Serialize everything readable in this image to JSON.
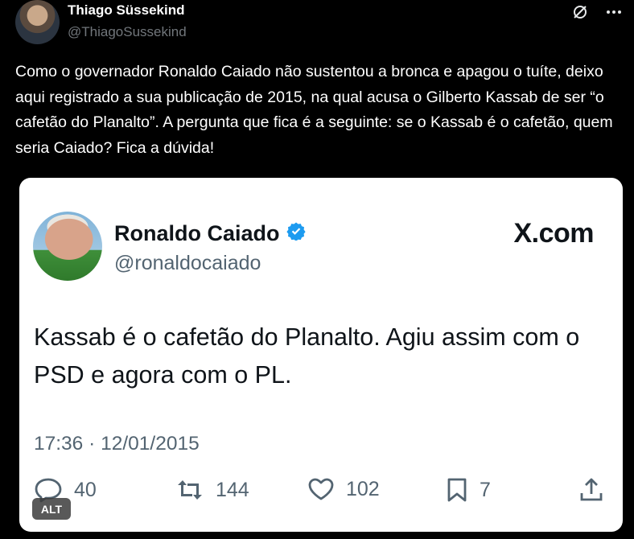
{
  "author": {
    "display_name": "Thiago Süssekind",
    "handle": "@ThiagoSussekind"
  },
  "post": {
    "text": "Como o governador Ronaldo Caiado não sustentou a bronca e apagou o tuíte, deixo aqui registrado a sua publicação de 2015, na qual acusa o Gilberto Kassab de ser “o cafetão do Planalto”. A pergunta que fica é a seguinte: se o Kassab é o cafetão, quem seria Caiado? Fica a dúvida!"
  },
  "embedded": {
    "display_name": "Ronaldo Caiado",
    "handle": "@ronaldocaiado",
    "brand": "X.com",
    "text": "Kassab é o cafetão do Planalto. Agiu assim com o PSD e agora com o PL.",
    "timestamp": "17:36 · 12/01/2015",
    "stats": {
      "replies": "40",
      "reposts": "144",
      "likes": "102",
      "bookmarks": "7"
    },
    "verified_color": "#1d9bf0"
  },
  "alt_badge": "ALT",
  "icons": [
    "grok-icon",
    "more-icon",
    "reply-icon",
    "repost-icon",
    "like-icon",
    "bookmark-icon",
    "share-icon",
    "verified-icon"
  ]
}
